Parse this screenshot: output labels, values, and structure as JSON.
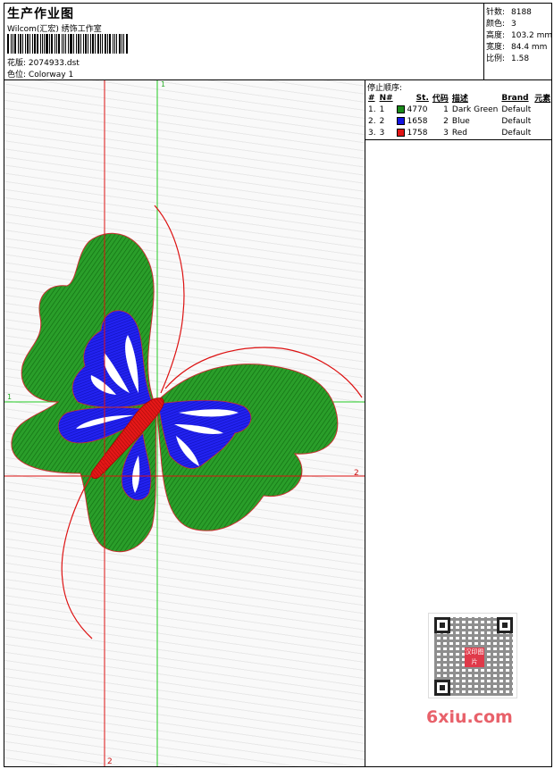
{
  "header": {
    "title": "生产作业图",
    "company": "Wilcom(汇宏) 绣饰工作室",
    "design_label": "花版:",
    "design_value": "2074933.dst",
    "colorway_label": "色位:",
    "colorway_value": "Colorway 1"
  },
  "stats": [
    {
      "label": "针数:",
      "value": "8188"
    },
    {
      "label": "颜色:",
      "value": "3"
    },
    {
      "label": "高度:",
      "value": "103.2 mm"
    },
    {
      "label": "宽度:",
      "value": "84.4 mm"
    },
    {
      "label": "比例:",
      "value": "1.58"
    }
  ],
  "stop_panel": {
    "title": "停止顺序:",
    "columns": [
      "#",
      "N#",
      "St.",
      "代码",
      "描述",
      "Brand",
      "元素"
    ],
    "rows": [
      {
        "index": "1.",
        "n": "1",
        "color": "#1a8a1a",
        "stitches": "4770",
        "code": "1",
        "desc": "Dark Green",
        "brand": "Default"
      },
      {
        "index": "2.",
        "n": "2",
        "color": "#1414e0",
        "stitches": "1658",
        "code": "2",
        "desc": "Blue",
        "brand": "Default"
      },
      {
        "index": "3.",
        "n": "3",
        "color": "#e01414",
        "stitches": "1758",
        "code": "3",
        "desc": "Red",
        "brand": "Default"
      }
    ]
  },
  "axes": {
    "v1": "1",
    "h1": "1",
    "h2": "2",
    "v2": "2"
  },
  "watermark": {
    "text": "6xiu.com",
    "badge": "汉印图片"
  },
  "colors": {
    "green": "#1f9a1f",
    "blue": "#1a1aee",
    "red": "#e01414",
    "axis_green": "#22cc22",
    "axis_red": "#dd1111"
  }
}
